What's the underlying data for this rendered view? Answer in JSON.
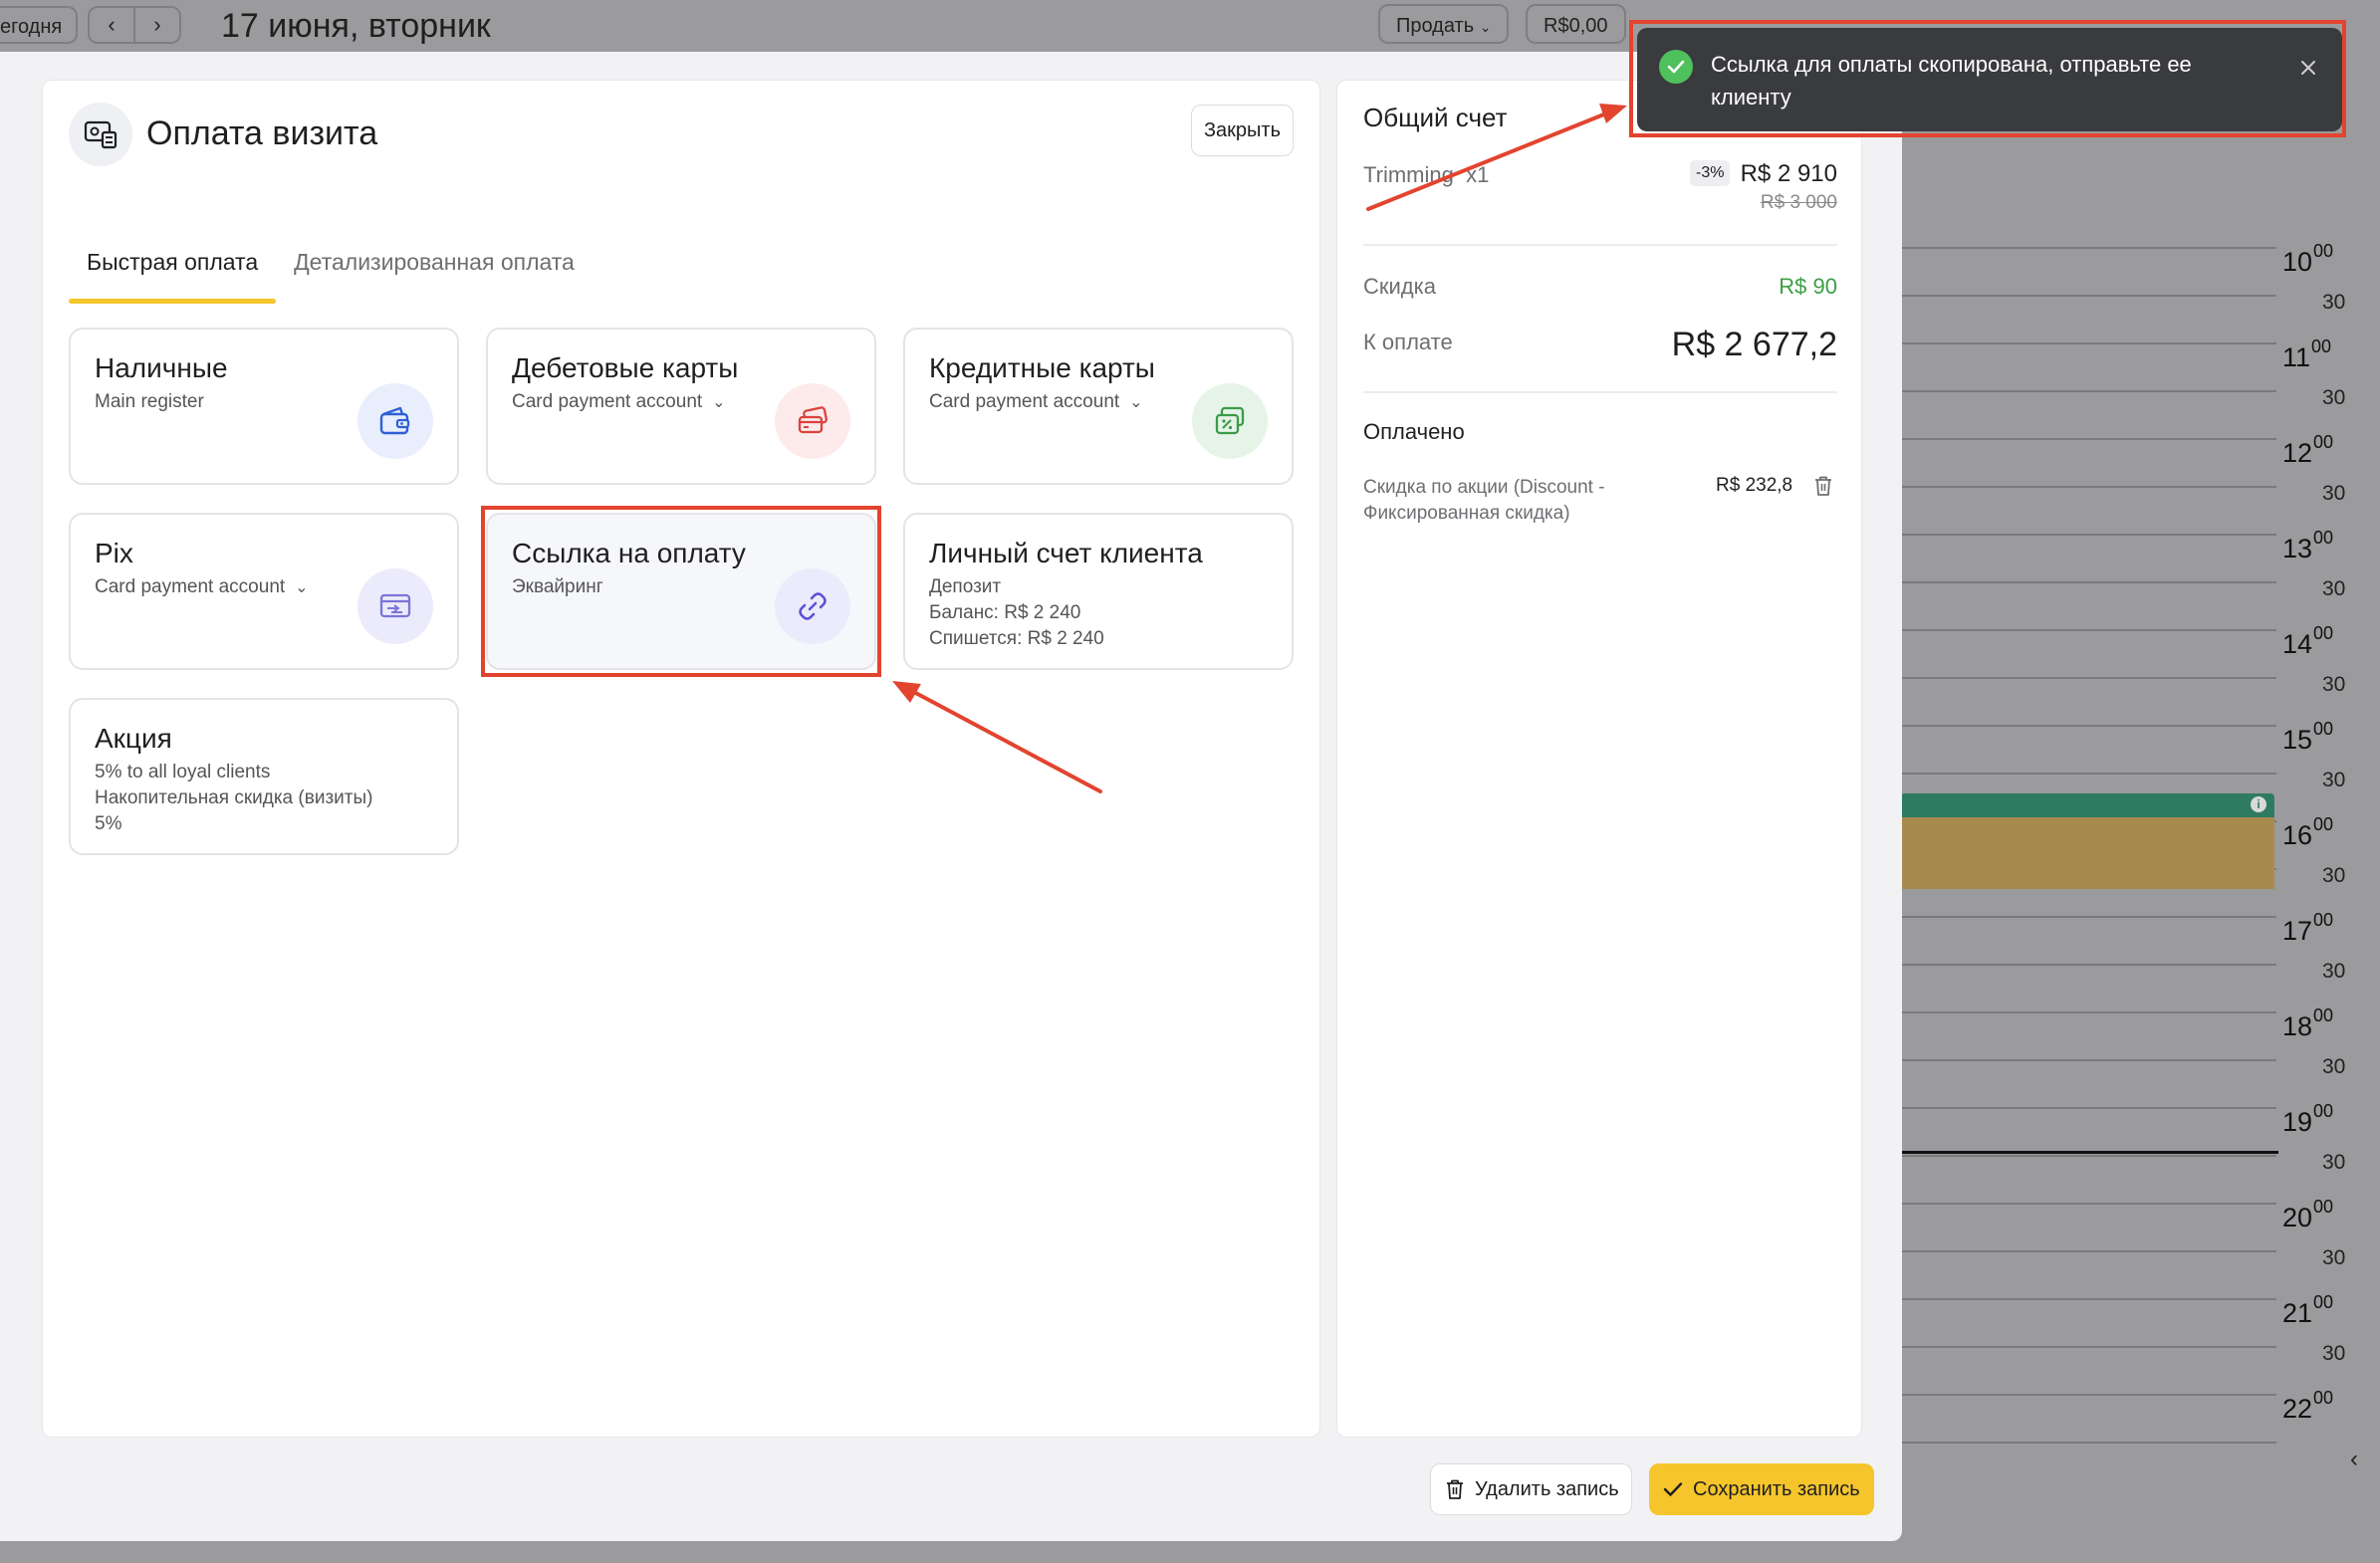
{
  "topbar": {
    "today_label": "егодня",
    "prev_icon": "chevron-left-icon",
    "next_icon": "chevron-right-icon",
    "date": "17 июня, вторник",
    "sell_label": "Продать",
    "money_label": "R$0,00"
  },
  "calendar": {
    "hours": [
      "10",
      "11",
      "12",
      "13",
      "14",
      "15",
      "16",
      "17",
      "18",
      "19",
      "20",
      "21",
      "22"
    ],
    "minutes_full": "00",
    "minutes_half": "30"
  },
  "modal": {
    "title": "Оплата визита",
    "close_label": "Закрыть",
    "tabs": [
      {
        "label": "Быстрая оплата",
        "active": true
      },
      {
        "label": "Детализированная оплата",
        "active": false
      }
    ],
    "methods": [
      {
        "title": "Наличные",
        "sub": "Main register",
        "icon": "wallet-icon",
        "dropdown": false
      },
      {
        "title": "Дебетовые карты",
        "sub": "Card payment account",
        "icon": "cards-icon",
        "dropdown": true
      },
      {
        "title": "Кредитные карты",
        "sub": "Card payment account",
        "icon": "credit-card-percent-icon",
        "dropdown": true
      },
      {
        "title": "Pix",
        "sub": "Card payment account",
        "icon": "pix-card-icon",
        "dropdown": true
      },
      {
        "title": "Ссылка на оплату",
        "sub": "Эквайринг",
        "icon": "link-icon",
        "dropdown": false,
        "selected": true
      },
      {
        "title": "Личный счет клиента",
        "lines": [
          "Депозит",
          "Баланс: R$ 2 240",
          "Спишется: R$ 2 240"
        ]
      },
      {
        "title": "Акция",
        "lines": [
          "5% to all loyal clients",
          "Накопительная скидка (визиты)",
          "5%"
        ]
      }
    ]
  },
  "bill": {
    "title": "Общий счет",
    "item_name": "Trimming",
    "item_qty": "x1",
    "item_discount": "-3%",
    "item_price": "R$ 2 910",
    "item_old_price": "R$ 3 000",
    "discount_label": "Скидка",
    "discount_value": "R$ 90",
    "to_pay_label": "К оплате",
    "to_pay_value": "R$ 2 677,2",
    "paid_title": "Оплачено",
    "paid_desc": "Скидка по акции (Discount - Фиксированная скидка)",
    "paid_amount": "R$ 232,8"
  },
  "footer": {
    "delete_label": "Удалить запись",
    "save_label": "Сохранить запись"
  },
  "toast": {
    "message": "Ссылка для оплаты скопирована, отправьте ее клиенту"
  },
  "colors": {
    "accent_yellow": "#f5c52b",
    "annotation_red": "#e2442f",
    "success_green": "#4fc15c",
    "discount_green": "#3aa046"
  }
}
